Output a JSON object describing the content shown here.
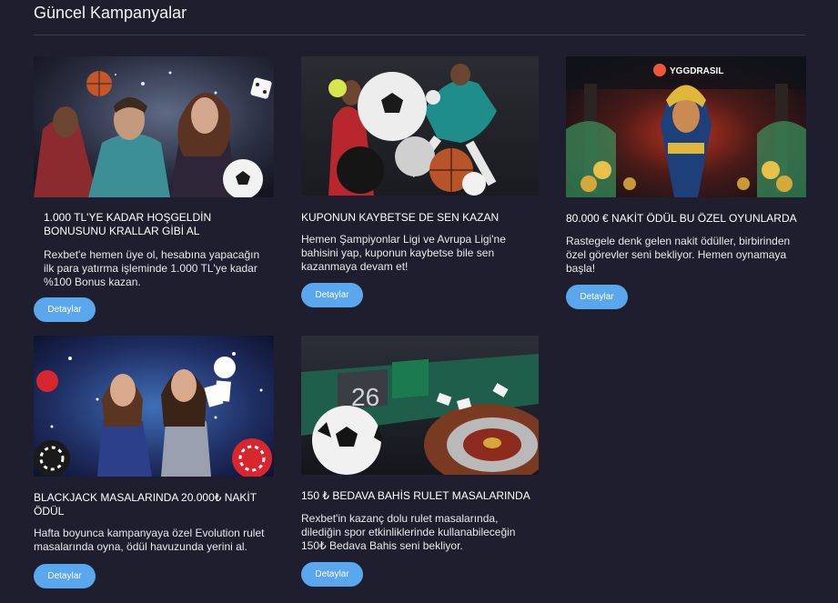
{
  "header": {
    "title": "Güncel Kampanyalar"
  },
  "cards": [
    {
      "title": "1.000 TL'YE KADAR HOŞGELDİN BONUSUNU KRALLAR GİBİ AL",
      "description": "Rexbet'e hemen üye ol, hesabına yapacağın ilk para yatırma işleminde 1.000 TL'ye kadar %100 Bonus kazan.",
      "button": "Detaylar",
      "image_alt": "sports-stars-welcome-banner"
    },
    {
      "title": "KUPONUN KAYBETSE DE SEN KAZAN",
      "description": "Hemen Şampiyonlar Ligi ve Avrupa Ligi'ne bahisini yap, kuponun kaybetse bile sen kazanmaya devam et!",
      "button": "Detaylar",
      "image_alt": "football-players-banner"
    },
    {
      "title": "80.000 € NAKİT ÖDÜL BU ÖZEL OYUNLARDA",
      "description": "Rastegele denk gelen nakit ödüller, birbirinden özel görevler seni bekliyor. Hemen oynamaya başla!",
      "button": "Detaylar",
      "image_alt": "yggdrasil-egyptian-slot-banner",
      "logo_text": "YGGDRASIL"
    },
    {
      "title": "BLACKJACK MASALARINDA 20.000₺ NAKİT ÖDÜL",
      "description": "Hafta boyunca kampanyaya özel Evolution rulet masalarında oyna, ödül havuzunda yerini al.",
      "button": "Detaylar",
      "image_alt": "blackjack-dealers-banner"
    },
    {
      "title": "150 ₺ BEDAVA BAHİS RULET MASALARINDA",
      "description": "Rexbet'in kazanç dolu rulet masalarında, dilediğin spor etkinliklerinde kullanabileceğin 150₺ Bedava Bahis seni bekliyor.",
      "button": "Detaylar",
      "image_alt": "roulette-football-banner",
      "roulette_number": "26"
    }
  ],
  "colors": {
    "background": "#1f1e2e",
    "button": "#5aa7ee",
    "divider": "#3b3a4f"
  }
}
